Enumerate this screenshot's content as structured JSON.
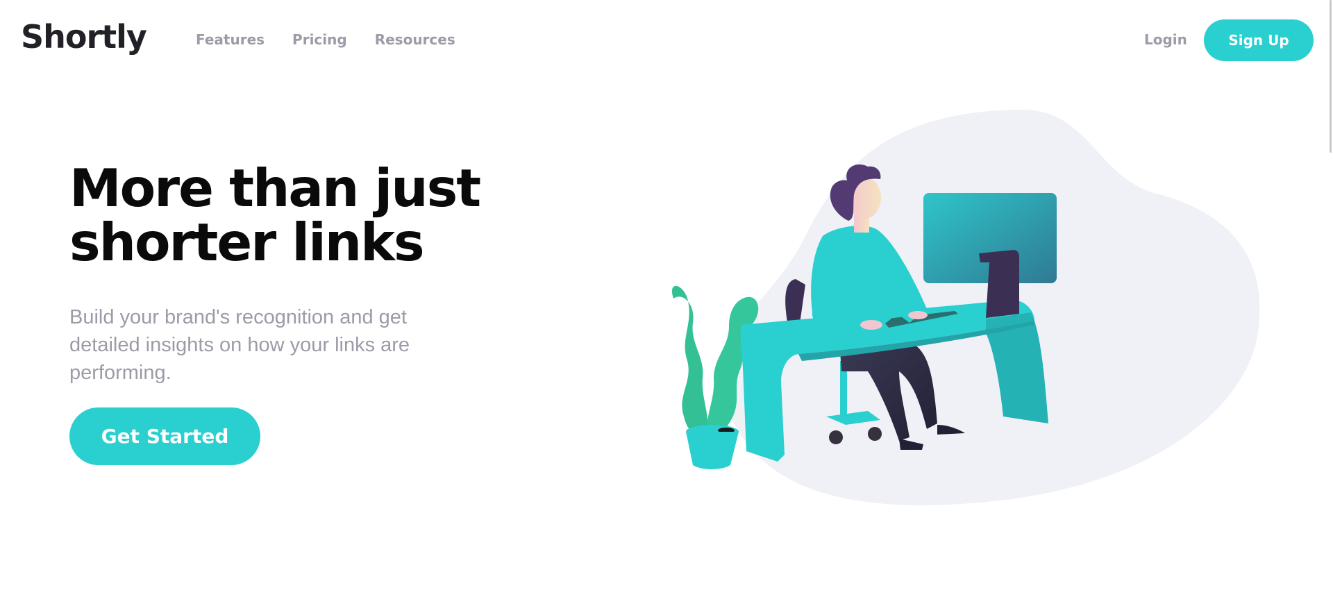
{
  "header": {
    "logo": "Shortly",
    "nav": [
      "Features",
      "Pricing",
      "Resources"
    ],
    "login_label": "Login",
    "signup_label": "Sign Up"
  },
  "hero": {
    "title": "More than just shorter links",
    "subtitle": "Build your brand's recognition and get detailed insights on how your links are performing.",
    "cta_label": "Get Started"
  },
  "colors": {
    "primary_cyan": "#2acfcf",
    "dark_violet": "#3b3054",
    "grayish_violet": "#9e9aa7",
    "very_dark_blue": "#35323e",
    "blob_gray": "#eff1f7"
  },
  "illustration": {
    "icon": "person-working-at-desk-illustration"
  }
}
